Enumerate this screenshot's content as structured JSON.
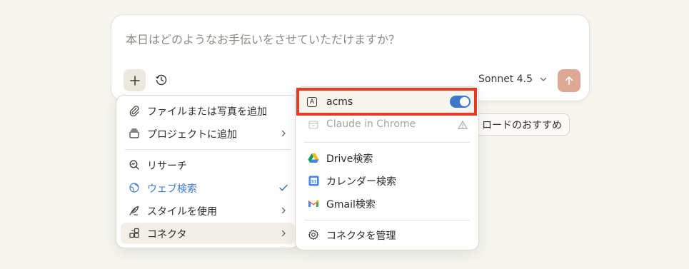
{
  "composer": {
    "placeholder": "本日はどのようなお手伝いをさせていただけますか？",
    "model_label": "Sonnet 4.5"
  },
  "suggestion": {
    "label": "ロードのおすすめ"
  },
  "left_menu": {
    "items": [
      {
        "label": "ファイルまたは写真を追加",
        "icon": "paperclip-icon"
      },
      {
        "label": "プロジェクトに追加",
        "icon": "project-icon"
      },
      {
        "label": "リサーチ",
        "icon": "research-icon"
      },
      {
        "label": "ウェブ検索",
        "icon": "globe-icon"
      },
      {
        "label": "スタイルを使用",
        "icon": "feather-icon"
      },
      {
        "label": "コネクタ",
        "icon": "connector-icon"
      }
    ]
  },
  "right_menu": {
    "items": [
      {
        "label": "acms",
        "icon": "acms-icon",
        "enabled": true
      },
      {
        "label": "Claude in Chrome",
        "icon": "chrome-extension-icon",
        "disabled": true
      },
      {
        "label": "Drive検索",
        "icon": "google-drive-icon"
      },
      {
        "label": "カレンダー検索",
        "icon": "google-calendar-icon"
      },
      {
        "label": "Gmail検索",
        "icon": "gmail-icon"
      },
      {
        "label": "コネクタを管理",
        "icon": "gear-icon"
      }
    ]
  },
  "colors": {
    "accent_blue": "#3d78c9",
    "send_button": "#dea894",
    "highlight_border": "#e63b22"
  }
}
